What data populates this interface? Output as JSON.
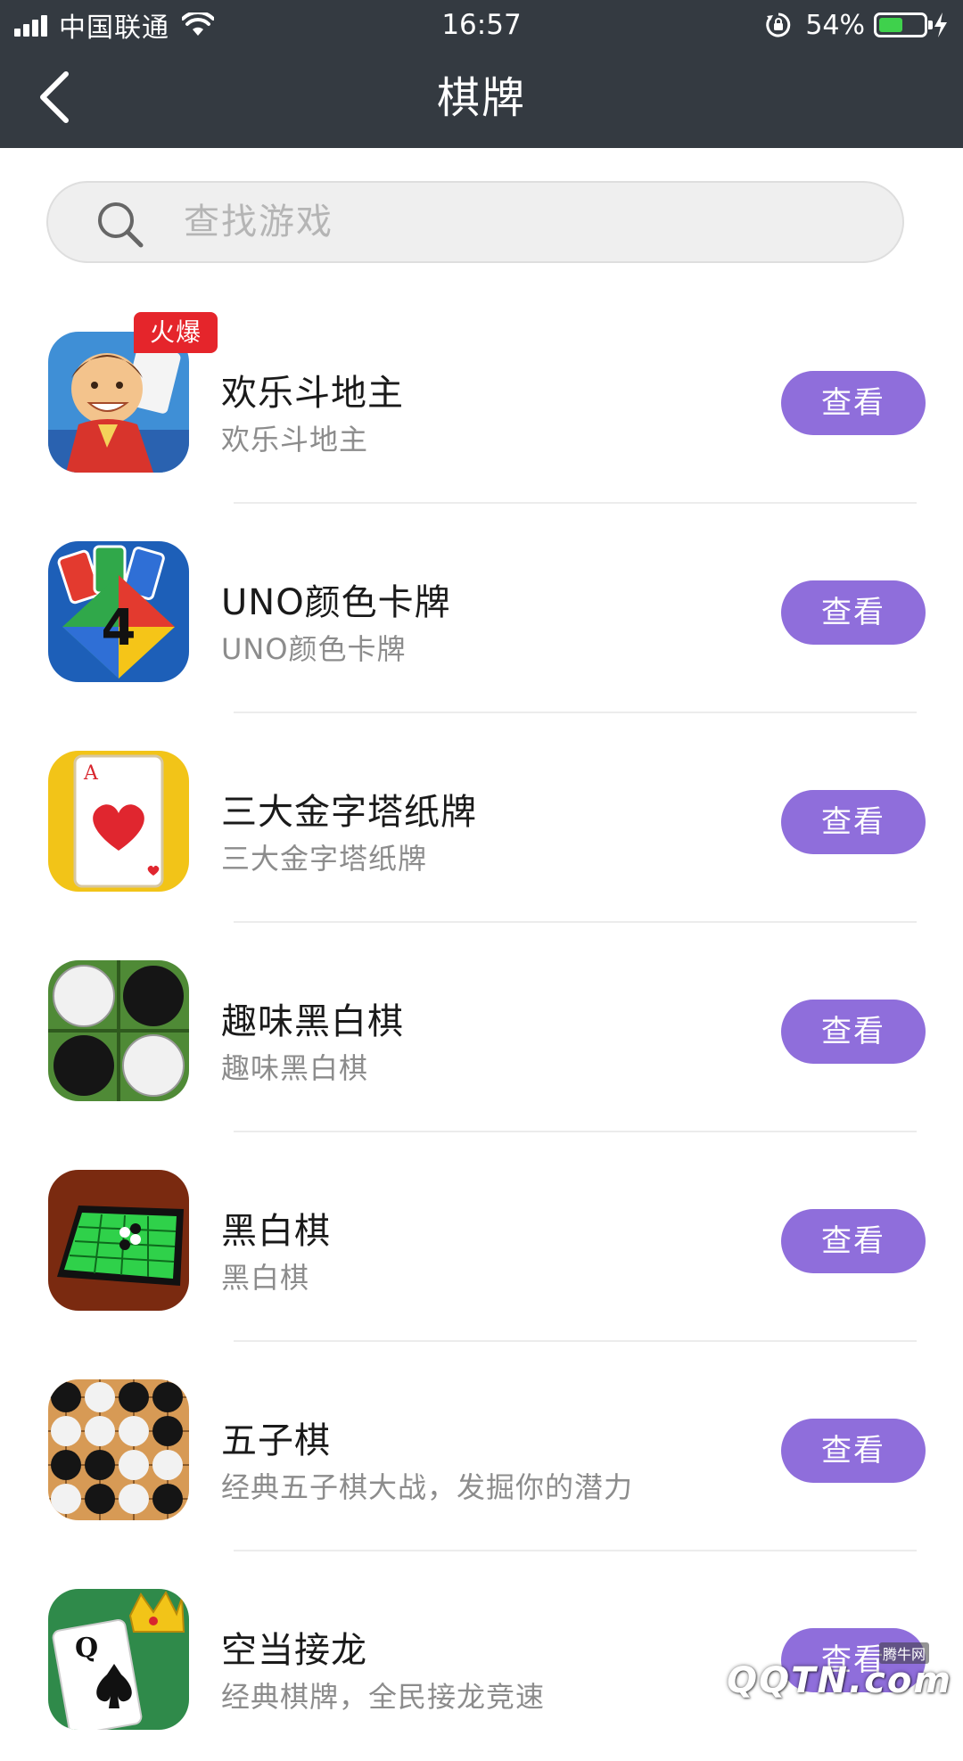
{
  "status_bar": {
    "carrier": "中国联通",
    "time": "16:57",
    "battery_percent": "54%",
    "battery_level": 0.54,
    "icons": [
      "signal-icon",
      "wifi-icon",
      "orientation-lock-icon",
      "battery-icon",
      "charging-icon"
    ]
  },
  "nav": {
    "title": "棋牌",
    "back_icon": "chevron-left-icon"
  },
  "search": {
    "placeholder": "查找游戏",
    "value": "",
    "icon": "search-icon"
  },
  "games": [
    {
      "name": "欢乐斗地主",
      "desc": "欢乐斗地主",
      "badge": "火爆",
      "button": "查看",
      "icon": "doudizhu-app-icon"
    },
    {
      "name": "UNO颜色卡牌",
      "desc": "UNO颜色卡牌",
      "badge": "",
      "button": "查看",
      "icon": "uno-cards-app-icon",
      "icon_text": "4"
    },
    {
      "name": "三大金字塔纸牌",
      "desc": "三大金字塔纸牌",
      "badge": "",
      "button": "查看",
      "icon": "ace-of-hearts-app-icon",
      "icon_text": "A"
    },
    {
      "name": "趣味黑白棋",
      "desc": "趣味黑白棋",
      "badge": "",
      "button": "查看",
      "icon": "reversi-stones-app-icon"
    },
    {
      "name": "黑白棋",
      "desc": "黑白棋",
      "badge": "",
      "button": "查看",
      "icon": "reversi-board-app-icon"
    },
    {
      "name": "五子棋",
      "desc": "经典五子棋大战，发掘你的潜力",
      "badge": "",
      "button": "查看",
      "icon": "gomoku-app-icon"
    },
    {
      "name": "空当接龙",
      "desc": "经典棋牌，全民接龙竞速",
      "badge": "",
      "button": "查看",
      "icon": "freecell-app-icon",
      "icon_text": "Q"
    }
  ],
  "colors": {
    "header_bg": "#343a41",
    "button_bg": "#8f6edb",
    "badge_bg": "#e5252b",
    "battery_fill": "#3fd14c"
  },
  "watermark": {
    "small": "腾牛网",
    "text": "QQTN.com"
  }
}
